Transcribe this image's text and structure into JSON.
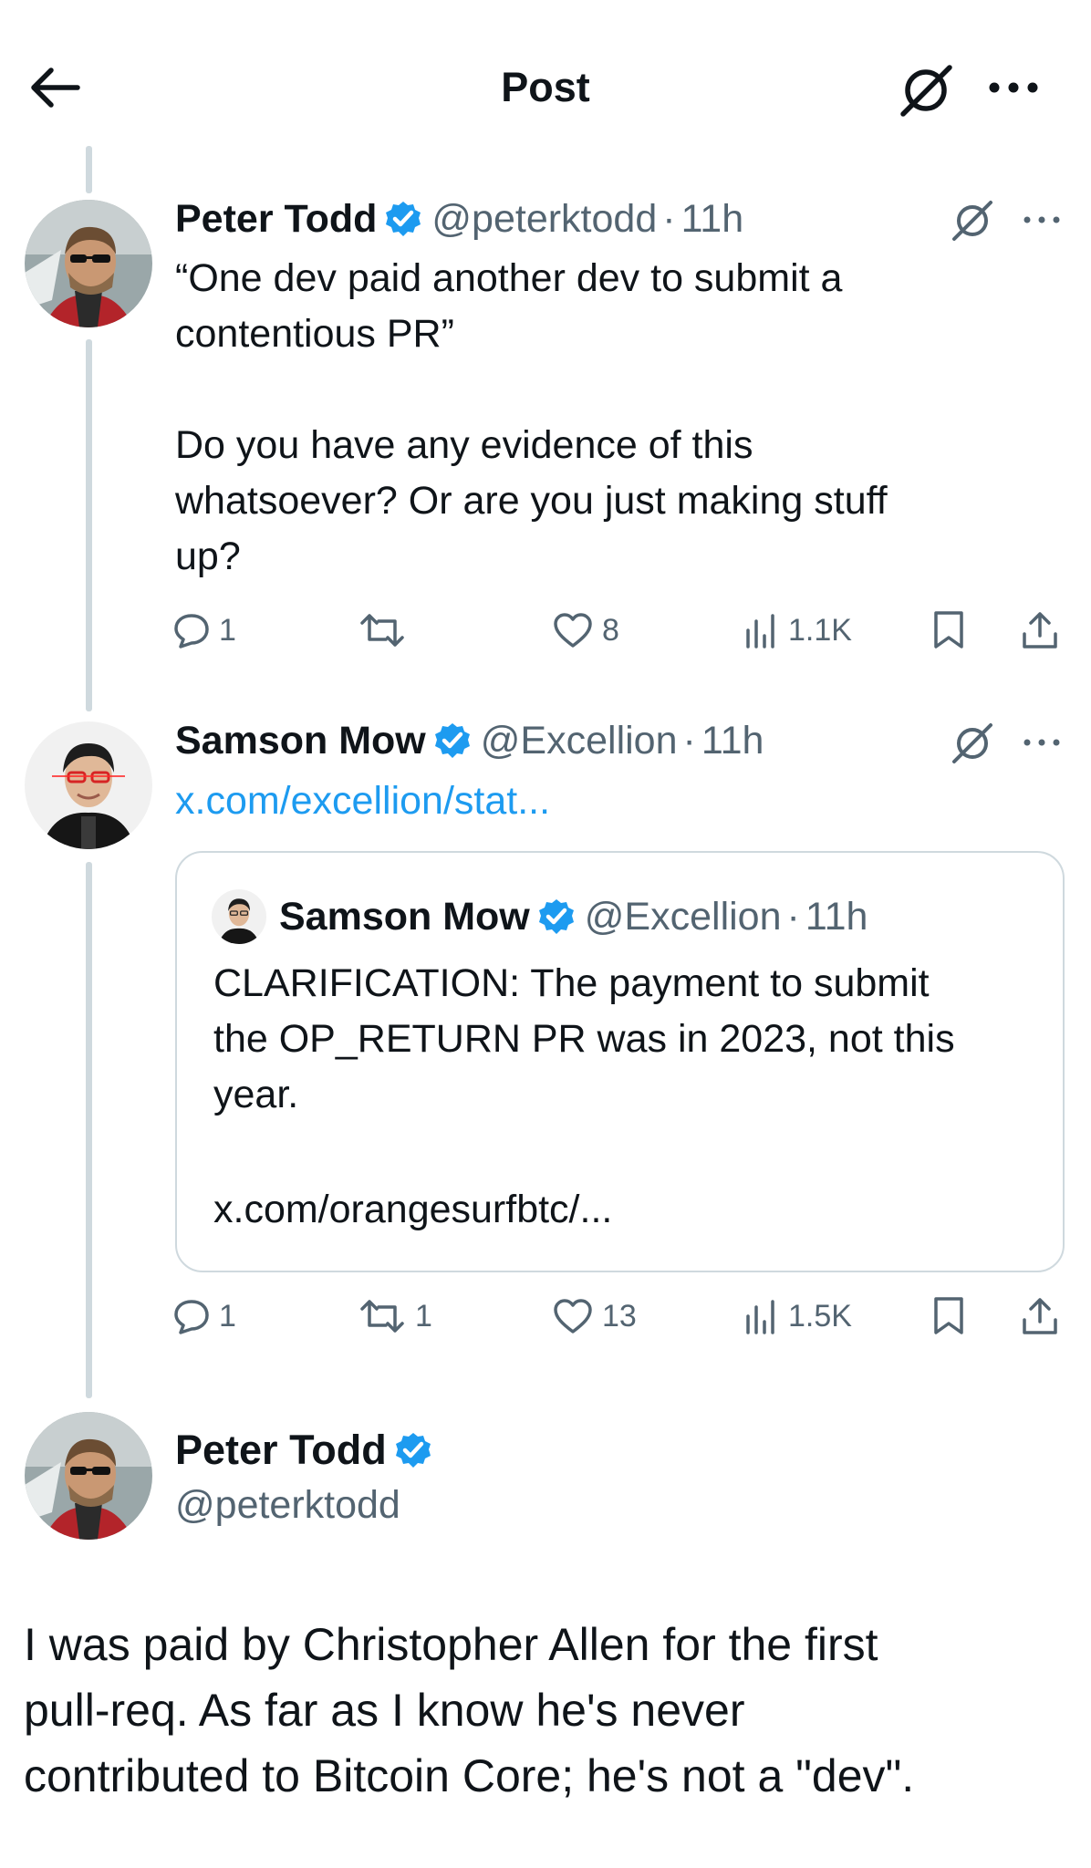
{
  "header": {
    "title": "Post",
    "back_icon": "arrow-left-icon",
    "grok_icon": "grok-icon",
    "more_icon": "more-horizontal-icon"
  },
  "colors": {
    "accent": "#1d9bf0",
    "secondary_text": "#536471",
    "border": "#cfd9de"
  },
  "posts": [
    {
      "name": "Peter Todd",
      "handle": "@peterktodd",
      "sep": "·",
      "time": "11h",
      "text": "“One dev paid another dev to submit a\ncontentious PR”\n\nDo you have any evidence of this\nwhatsoever? Or are you just making stuff\nup?",
      "stats": {
        "replies": "1",
        "reposts": "",
        "likes": "8",
        "views": "1.1K"
      }
    },
    {
      "name": "Samson Mow",
      "handle": "@Excellion",
      "sep": "·",
      "time": "11h",
      "link": "x.com/excellion/stat...",
      "quote": {
        "name": "Samson Mow",
        "handle": "@Excellion",
        "sep": "·",
        "time": "11h",
        "text": "CLARIFICATION: The payment to submit\nthe OP_RETURN PR was in 2023, not this\nyear.",
        "link": "x.com/orangesurfbtc/..."
      },
      "stats": {
        "replies": "1",
        "reposts": "1",
        "likes": "13",
        "views": "1.5K"
      }
    }
  ],
  "main_post": {
    "name": "Peter Todd",
    "handle": "@peterktodd",
    "text": "I was paid by Christopher Allen for the first\npull-req. As far as I know he's never\ncontributed to Bitcoin Core; he's not a \"dev\"."
  }
}
